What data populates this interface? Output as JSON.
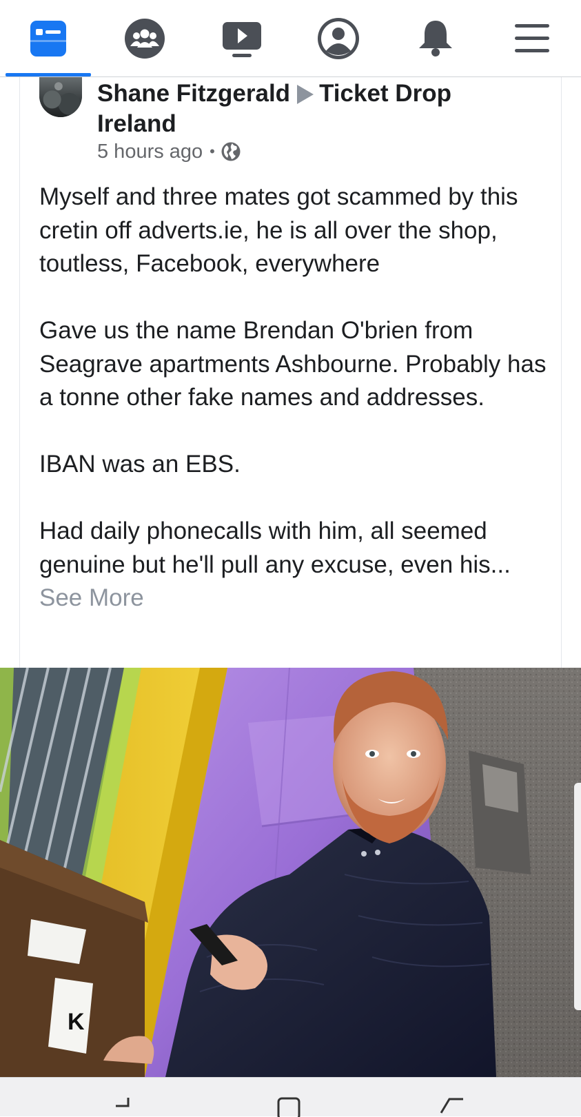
{
  "nav": {
    "items": [
      {
        "name": "news-feed-icon",
        "active": true
      },
      {
        "name": "groups-icon",
        "active": false
      },
      {
        "name": "watch-icon",
        "active": false
      },
      {
        "name": "profile-icon",
        "active": false
      },
      {
        "name": "notifications-bell-icon",
        "active": false
      },
      {
        "name": "menu-icon",
        "active": false
      }
    ],
    "active_color": "#1877f2",
    "inactive_color": "#4b4f56"
  },
  "post": {
    "author": "Shane Fitzgerald",
    "group_line1": "Ticket Drop",
    "group_line2": "Ireland",
    "timestamp": "5 hours ago",
    "separator": "•",
    "privacy_icon": "globe-icon",
    "paragraphs": [
      "Myself and three mates got scammed by this cretin off adverts.ie, he is all over the shop, toutless, Facebook, everywhere",
      "Gave us the name Brendan O'brien from Seagrave apartments Ashbourne. Probably has a tonne other fake names and addresses.",
      "IBAN was an EBS.",
      "Had daily phonecalls with him, all seemed genuine but he'll pull any excuse, even his..."
    ],
    "see_more": "See More"
  },
  "photo": {
    "bin_label": "K"
  },
  "system_nav": {
    "buttons": [
      "recent-apps-icon",
      "home-icon",
      "back-icon"
    ]
  }
}
